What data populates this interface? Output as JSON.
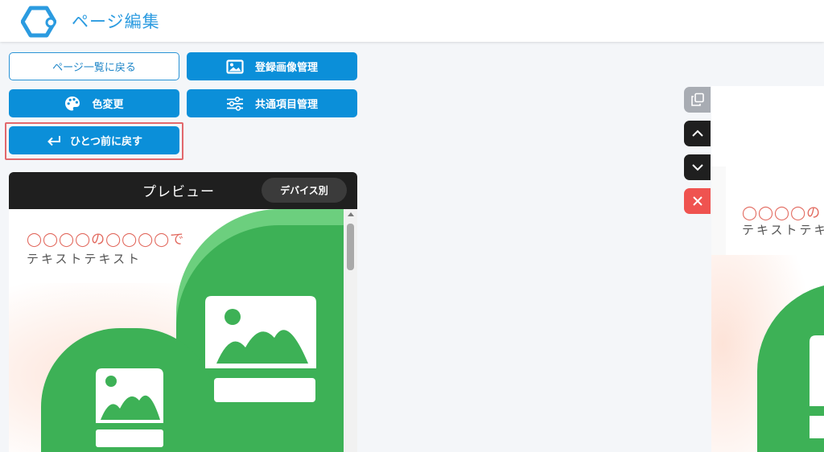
{
  "header": {
    "title": "ページ編集",
    "logo_color": "#2b9be0"
  },
  "buttons": {
    "back_to_list": "ページ一覧に戻る",
    "image_manage": "登録画像管理",
    "color_change": "色変更",
    "common_items": "共通項目管理",
    "undo": "ひとつ前に戻す"
  },
  "preview": {
    "title": "プレビュー",
    "device_button": "デバイス別",
    "text_line1": "◯◯◯◯の◯◯◯◯で",
    "text_line2": "テキストテキスト"
  },
  "editor": {
    "text_line1": "◯◯◯◯の",
    "text_line2": "テキストテキ"
  },
  "colors": {
    "primary": "#0b8fd9",
    "green": "#3db156",
    "light_green": "#6ccf7e",
    "delete_red": "#ef5350",
    "highlight": "#e2686c"
  }
}
